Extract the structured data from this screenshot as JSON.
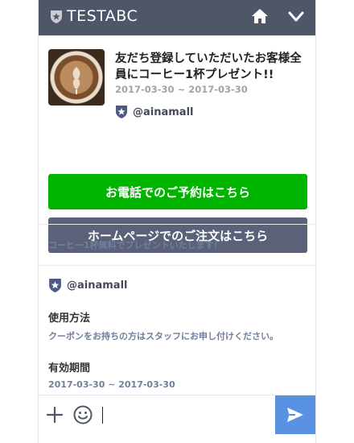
{
  "header": {
    "title": "TESTABC"
  },
  "coupon": {
    "title": "友だち登録していただいたお客様全員にコーヒー1杯プレゼント!!",
    "date_range": "2017-03-30 ~ 2017-03-30",
    "account": "@ainamall"
  },
  "buttons": {
    "call": "お電話でのご予約はこちら",
    "order": "ホームページでのご注文はこちら"
  },
  "note": "コーヒー1杯無料でプレゼントいたします！",
  "detail": {
    "account": "@ainamall",
    "usage_title": "使用方法",
    "usage_text": "クーポンをお持ちの方はスタッフにお申し付けください。",
    "validity_title": "有効期間",
    "validity_text": "2017-03-30 ~ 2017-03-30"
  },
  "colors": {
    "header_bg": "#4f5668",
    "call_button": "#00b400",
    "order_button": "#5a6178",
    "send_button": "#5991e3",
    "muted_text": "#6f7f9c"
  },
  "icons": {
    "logo": "shield-star-icon",
    "home": "home-icon",
    "menu": "chevron-down-icon",
    "badge": "shield-star-icon",
    "add": "plus-icon",
    "emoji": "smiley-icon",
    "send": "paper-plane-icon"
  }
}
